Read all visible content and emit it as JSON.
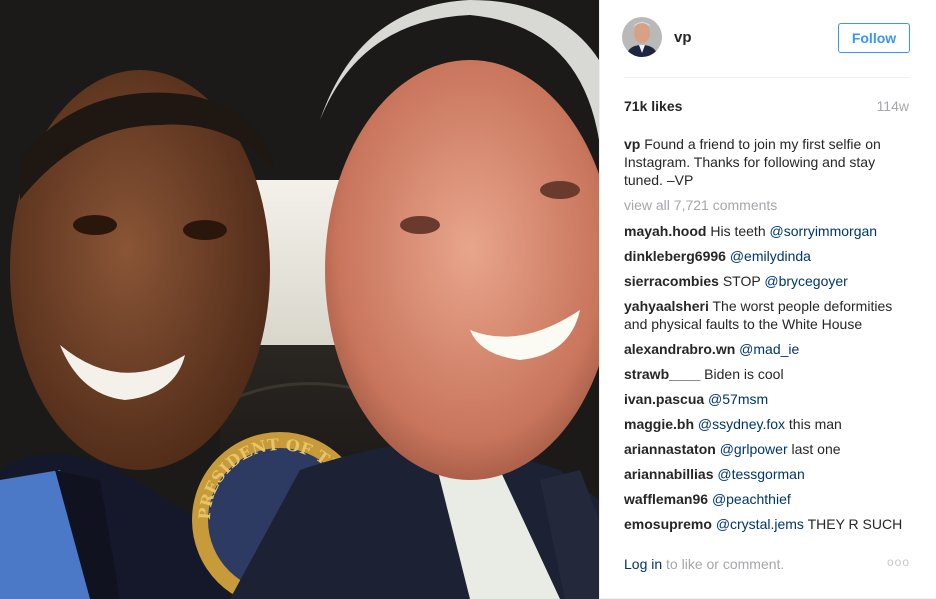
{
  "post": {
    "username": "vp",
    "follow_label": "Follow",
    "likes": "71k likes",
    "age": "114w",
    "caption": {
      "username": "vp",
      "text": "Found a friend to join my first selfie on Instagram. Thanks for following and stay tuned. –VP"
    },
    "view_all": "view all 7,721 comments",
    "photo": {
      "seal_text": "PRESIDENT OF THE"
    },
    "comments": [
      {
        "user": "mayah.hood",
        "text": "His teeth",
        "mention": "@sorryimmorgan",
        "after": ""
      },
      {
        "user": "dinkleberg6996",
        "text": "",
        "mention": "@emilydinda",
        "after": ""
      },
      {
        "user": "sierracombies",
        "text": "STOP",
        "mention": "@brycegoyer",
        "after": ""
      },
      {
        "user": "yahyaalsheri",
        "text": "The worst people deformities and physical faults to the White House",
        "mention": "",
        "after": ""
      },
      {
        "user": "alexandrabro.wn",
        "text": "",
        "mention": "@mad_ie",
        "after": ""
      },
      {
        "user": "strawb____",
        "text": "Biden is cool",
        "mention": "",
        "after": ""
      },
      {
        "user": "ivan.pascua",
        "text": "",
        "mention": "@57msm",
        "after": ""
      },
      {
        "user": "maggie.bh",
        "text": "",
        "mention": "@ssydney.fox",
        "after": "this man"
      },
      {
        "user": "ariannastaton",
        "text": "",
        "mention": "@grlpower",
        "after": "last one"
      },
      {
        "user": "ariannabillias",
        "text": "",
        "mention": "@tessgorman",
        "after": ""
      },
      {
        "user": "waffleman96",
        "text": "",
        "mention": "@peachthief",
        "after": ""
      },
      {
        "user": "emosupremo",
        "text": "",
        "mention": "@crystal.jems",
        "after": "THEY R SUCH"
      }
    ],
    "footer": {
      "login": "Log in",
      "rest": "to like or comment."
    },
    "more_icon": "ooo"
  },
  "colors": {
    "accent": "#3897f0",
    "link": "#003569",
    "muted": "#a5a7aa",
    "text": "#262626"
  }
}
